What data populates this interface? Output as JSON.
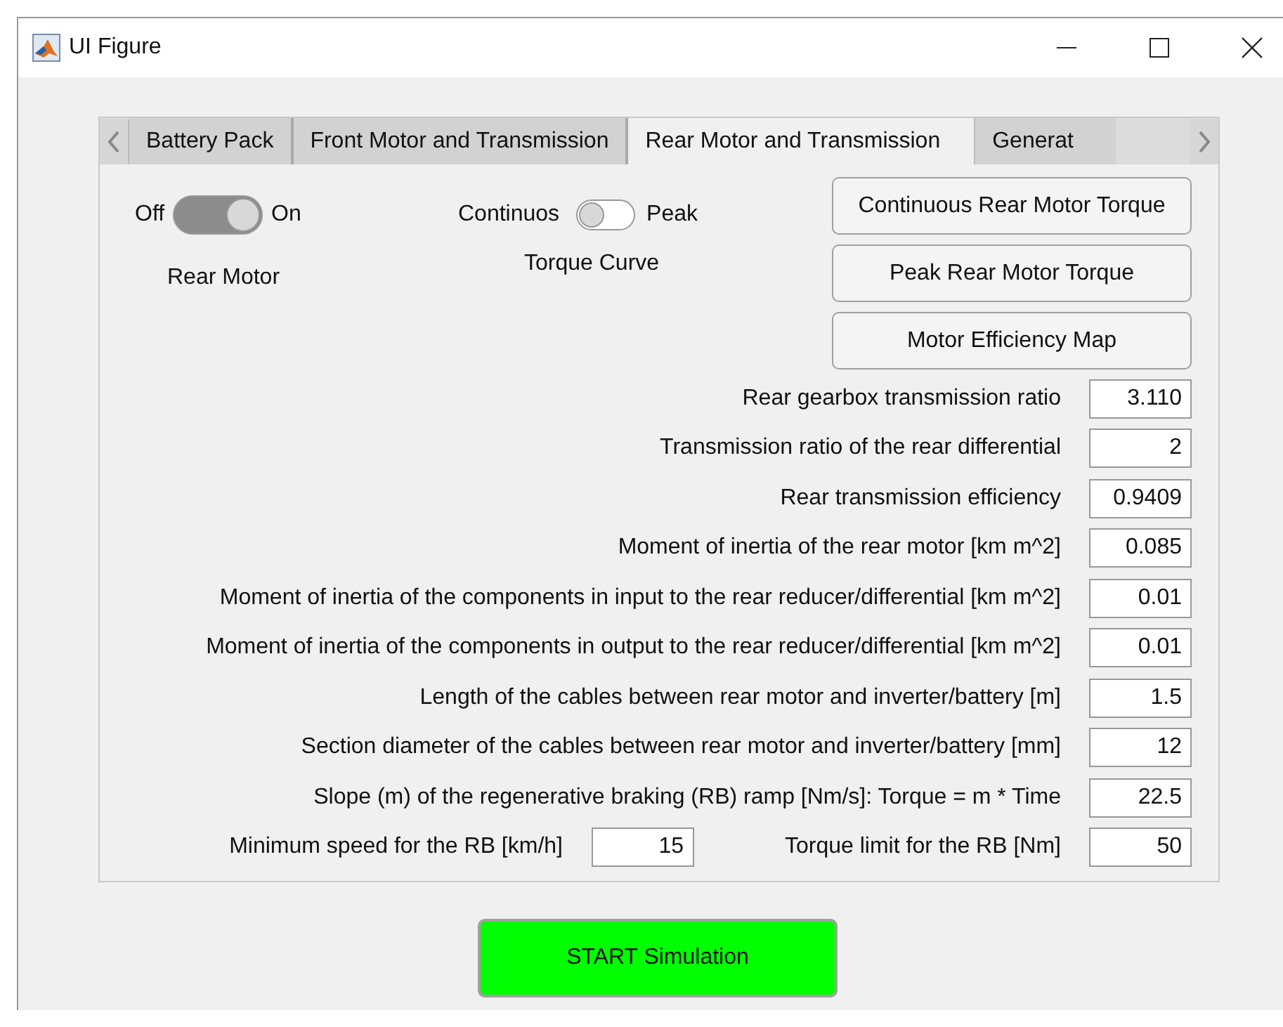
{
  "window": {
    "title": "UI Figure"
  },
  "tabs": [
    {
      "label": "Battery Pack",
      "selected": false
    },
    {
      "label": "Front Motor and Transmission",
      "selected": false
    },
    {
      "label": "Rear Motor and Transmission",
      "selected": true
    },
    {
      "label": "Generat",
      "selected": false
    }
  ],
  "rear_motor": {
    "off_label": "Off",
    "on_label": "On",
    "on": true,
    "caption": "Rear Motor"
  },
  "torque_curve": {
    "off_label": "Continuos",
    "on_label": "Peak",
    "on": false,
    "caption": "Torque Curve"
  },
  "buttons": [
    "Continuous Rear Motor Torque",
    "Peak Rear Motor Torque",
    "Motor Efficiency Map"
  ],
  "parameters": [
    {
      "label": "Rear gearbox transmission ratio",
      "value": "3.110"
    },
    {
      "label": "Transmission ratio of the rear differential",
      "value": "2"
    },
    {
      "label": "Rear transmission efficiency",
      "value": "0.9409"
    },
    {
      "label": "Moment of inertia of the rear motor [km m^2]",
      "value": "0.085"
    },
    {
      "label": "Moment of inertia of the components in input to the rear reducer/differential [km m^2]",
      "value": "0.01"
    },
    {
      "label": "Moment of inertia of the components in output to the rear reducer/differential [km m^2]",
      "value": "0.01"
    },
    {
      "label": "Length of the cables between rear motor and inverter/battery [m]",
      "value": "1.5"
    },
    {
      "label": "Section diameter of the cables between rear motor and inverter/battery [mm]",
      "value": "12"
    },
    {
      "label": "Slope (m) of the regenerative braking (RB) ramp [Nm/s]: Torque = m * Time",
      "value": "22.5"
    }
  ],
  "last_row": [
    {
      "label": "Minimum speed for the RB [km/h]",
      "value": "15"
    },
    {
      "label": "Torque limit for the RB [Nm]",
      "value": "50"
    }
  ],
  "start_button": "START Simulation"
}
